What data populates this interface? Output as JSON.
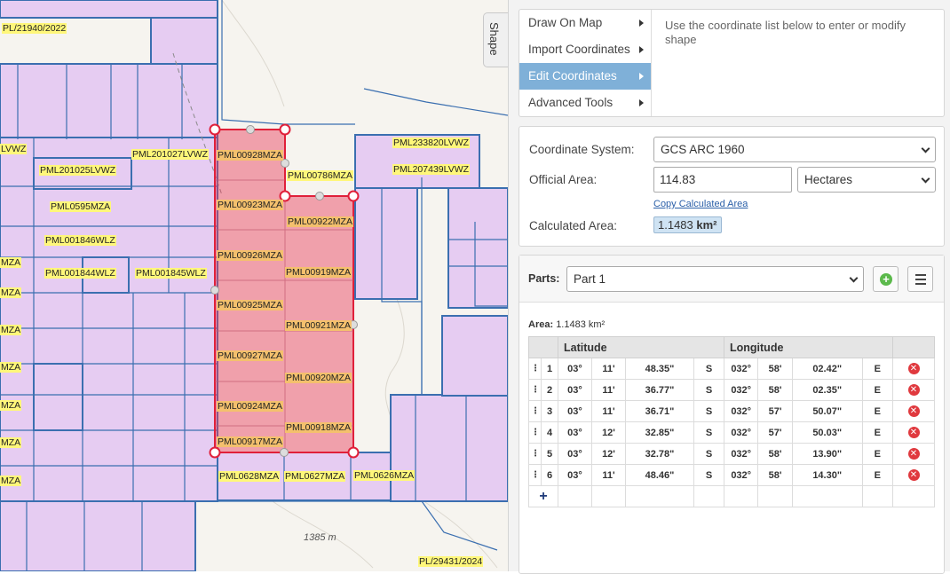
{
  "map": {
    "labels": {
      "l1": "PL/21940/2022",
      "l2": "LVWZ",
      "l3": "PML201027LVWZ",
      "l4": "PML00928MZA",
      "l5": "PML233820LVWZ",
      "l6": "PML201025LVWZ",
      "l7": "PML00786MZA",
      "l8": "PML207439LVWZ",
      "l9": "PML0595MZA",
      "l10": "PML00923MZA",
      "l11": "PML00922MZA",
      "l12": "PML001846WLZ",
      "l13": "MZA",
      "l14": "PML001844WLZ",
      "l15": "PML001845WLZ",
      "l16": "PML00926MZA",
      "l17": "PML00919MZA",
      "l18": "MZA",
      "l19": "PML00925MZA",
      "l20": "PML00921MZA",
      "l21": "MZA",
      "l22": "PML00927MZA",
      "l23": "MZA",
      "l24": "PML00920MZA",
      "l25": "MZA",
      "l26": "PML00924MZA",
      "l27": "PML00918MZA",
      "l28": "MZA",
      "l29": "PML00917MZA",
      "l30": "PML0628MZA",
      "l31": "PML0627MZA",
      "l32": "PML0626MZA",
      "l33": "MZA",
      "l34": "PL/29431/2024"
    },
    "elevation": "1385 m",
    "colors": {
      "parcel_fill": "#e6ccf2",
      "parcel_border": "#3b6fb0",
      "selection": "#e0203a",
      "label_bg": "#fff77a"
    }
  },
  "shape_tab": "Shape",
  "menu": {
    "items": [
      {
        "label": "Draw On Map",
        "active": false
      },
      {
        "label": "Import Coordinates",
        "active": false
      },
      {
        "label": "Edit Coordinates",
        "active": true
      },
      {
        "label": "Advanced Tools",
        "active": false
      }
    ],
    "description": "Use the coordinate list below to enter or modify shape"
  },
  "coords": {
    "system_label": "Coordinate System:",
    "system_value": "GCS ARC 1960",
    "official_label": "Official Area:",
    "official_value": "114.83",
    "unit_value": "Hectares",
    "copy_link": "Copy Calculated Area",
    "calc_label": "Calculated Area:",
    "calc_value": "1.1483",
    "calc_unit": "km²"
  },
  "parts": {
    "label": "Parts:",
    "selected": "Part 1",
    "area_label": "Area:",
    "area_value": "1.1483 km²",
    "headers": {
      "lat": "Latitude",
      "lon": "Longitude"
    },
    "rows": [
      {
        "n": "1",
        "lat_d": "03°",
        "lat_m": "11'",
        "lat_s": "48.35\"",
        "ns": "S",
        "lon_d": "032°",
        "lon_m": "58'",
        "lon_s": "02.42\"",
        "ew": "E"
      },
      {
        "n": "2",
        "lat_d": "03°",
        "lat_m": "11'",
        "lat_s": "36.77\"",
        "ns": "S",
        "lon_d": "032°",
        "lon_m": "58'",
        "lon_s": "02.35\"",
        "ew": "E"
      },
      {
        "n": "3",
        "lat_d": "03°",
        "lat_m": "11'",
        "lat_s": "36.71\"",
        "ns": "S",
        "lon_d": "032°",
        "lon_m": "57'",
        "lon_s": "50.07\"",
        "ew": "E"
      },
      {
        "n": "4",
        "lat_d": "03°",
        "lat_m": "12'",
        "lat_s": "32.85\"",
        "ns": "S",
        "lon_d": "032°",
        "lon_m": "57'",
        "lon_s": "50.03\"",
        "ew": "E"
      },
      {
        "n": "5",
        "lat_d": "03°",
        "lat_m": "12'",
        "lat_s": "32.78\"",
        "ns": "S",
        "lon_d": "032°",
        "lon_m": "58'",
        "lon_s": "13.90\"",
        "ew": "E"
      },
      {
        "n": "6",
        "lat_d": "03°",
        "lat_m": "11'",
        "lat_s": "48.46\"",
        "ns": "S",
        "lon_d": "032°",
        "lon_m": "58'",
        "lon_s": "14.30\"",
        "ew": "E"
      }
    ]
  }
}
